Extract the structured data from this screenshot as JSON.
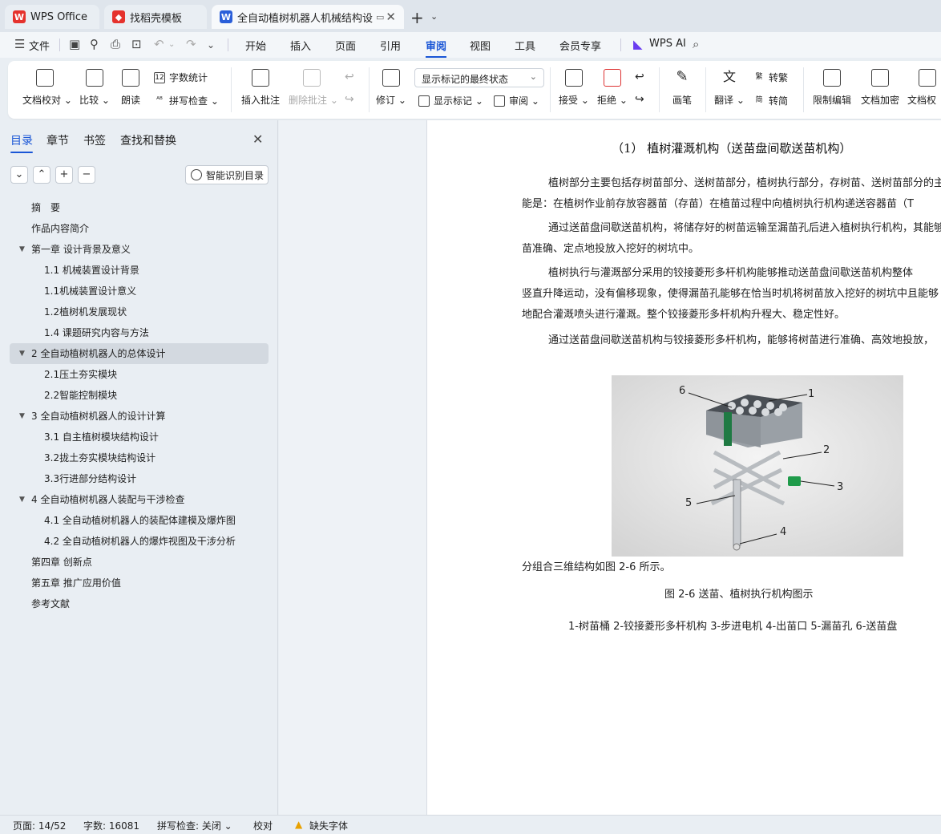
{
  "tabs": [
    {
      "label": "WPS Office",
      "icon": "wps-logo-icon"
    },
    {
      "label": "找稻壳模板",
      "icon": "docer-icon"
    },
    {
      "label": "全自动植树机器人机械结构设",
      "icon": "word-doc-icon"
    }
  ],
  "menu": {
    "file": "文件",
    "items": [
      "开始",
      "插入",
      "页面",
      "引用",
      "审阅",
      "视图",
      "工具",
      "会员专享"
    ],
    "active": "审阅",
    "ai": "WPS AI"
  },
  "ribbon": {
    "doc_proof": "文档校对",
    "compare": "比较",
    "read_aloud": "朗读",
    "word_count": "字数统计",
    "spell_check": "拼写检查",
    "insert_comment": "插入批注",
    "delete_comment": "删除批注",
    "revise": "修订",
    "markup_select": "显示标记的最终状态",
    "show_markup": "显示标记",
    "review": "审阅",
    "accept": "接受",
    "reject": "拒绝",
    "pen": "画笔",
    "translate": "翻译",
    "to_traditional": "转繁",
    "to_simplified": "转简",
    "restrict_edit": "限制编辑",
    "encrypt": "文档加密",
    "doc_more": "文档权"
  },
  "nav": {
    "tabs": [
      "目录",
      "章节",
      "书签",
      "查找和替换"
    ],
    "smart_toc": "智能识别目录",
    "toc": [
      {
        "label": "摘　要",
        "level": 1,
        "arrow": false
      },
      {
        "label": "作品内容简介",
        "level": 1,
        "arrow": false
      },
      {
        "label": "第一章  设计背景及意义",
        "level": 1,
        "arrow": true
      },
      {
        "label": "1.1 机械装置设计背景",
        "level": 2,
        "arrow": false
      },
      {
        "label": "1.1机械装置设计意义",
        "level": 2,
        "arrow": false
      },
      {
        "label": "1.2植树机发展现状",
        "level": 2,
        "arrow": false
      },
      {
        "label": "1.4 课题研究内容与方法",
        "level": 2,
        "arrow": false
      },
      {
        "label": "2 全自动植树机器人的总体设计",
        "level": 1,
        "arrow": true,
        "selected": true
      },
      {
        "label": "2.1压土夯实模块",
        "level": 2,
        "arrow": false
      },
      {
        "label": "2.2智能控制模块",
        "level": 2,
        "arrow": false
      },
      {
        "label": "3 全自动植树机器人的设计计算",
        "level": 1,
        "arrow": true
      },
      {
        "label": "3.1 自主植树模块结构设计",
        "level": 2,
        "arrow": false
      },
      {
        "label": "3.2拢土夯实模块结构设计",
        "level": 2,
        "arrow": false
      },
      {
        "label": "3.3行进部分结构设计",
        "level": 2,
        "arrow": false
      },
      {
        "label": "4 全自动植树机器人装配与干涉检查",
        "level": 1,
        "arrow": true
      },
      {
        "label": "4.1  全自动植树机器人的装配体建模及爆炸图",
        "level": 2,
        "arrow": false
      },
      {
        "label": "4.2 全自动植树机器人的爆炸视图及干涉分析",
        "level": 2,
        "arrow": false
      },
      {
        "label": "第四章  创新点",
        "level": 1,
        "arrow": false
      },
      {
        "label": "第五章  推广应用价值",
        "level": 1,
        "arrow": false
      },
      {
        "label": "参考文献",
        "level": 1,
        "arrow": false
      }
    ]
  },
  "document": {
    "heading": "（1）   植树灌溉机构（送苗盘间歇送苗机构）",
    "paragraphs": [
      [
        "植树部分主要包括存树苗部分、送树苗部分，植树执行部分，存树苗、送树苗部分的主",
        "能是：在植树作业前存放容器苗（存苗）在植苗过程中向植树执行机构递送容器苗（T"
      ],
      [
        "通过送苗盘间歇送苗机构，将储存好的树苗运输至漏苗孔后进入植树执行机构，其能够",
        "苗准确、定点地投放入挖好的树坑中。"
      ],
      [
        "植树执行与灌溉部分采用的铰接菱形多杆机构能够推动送苗盘间歇送苗机构整体",
        "竖直升降运动，没有偏移现象，使得漏苗孔能够在恰当时机将树苗放入挖好的树坑中且能够",
        "地配合灌溉喷头进行灌溉。整个铰接菱形多杆机构升程大、稳定性好。"
      ],
      [
        "通过送苗盘间歇送苗机构与铰接菱形多杆机构，能够将树苗进行准确、高效地投放，"
      ]
    ],
    "figure_labels": [
      "1",
      "2",
      "3",
      "4",
      "5",
      "6"
    ],
    "after_figure": "分组合三维结构如图 2-6 所示。",
    "figure_caption": "图 2-6  送苗、植树执行机构图示",
    "legend": "1-树苗桶  2-铰接菱形多杆机构  3-步进电机  4-出苗口  5-漏苗孔  6-送苗盘"
  },
  "status": {
    "page": "页面: 14/52",
    "words": "字数: 16081",
    "spell": "拼写检查: 关闭",
    "proof": "校对",
    "missing_font": "缺失字体"
  },
  "colors": {
    "accent": "#1a56d6",
    "wps_red": "#e5322d",
    "word_blue": "#2b5fd9",
    "warn": "#e8a100"
  }
}
